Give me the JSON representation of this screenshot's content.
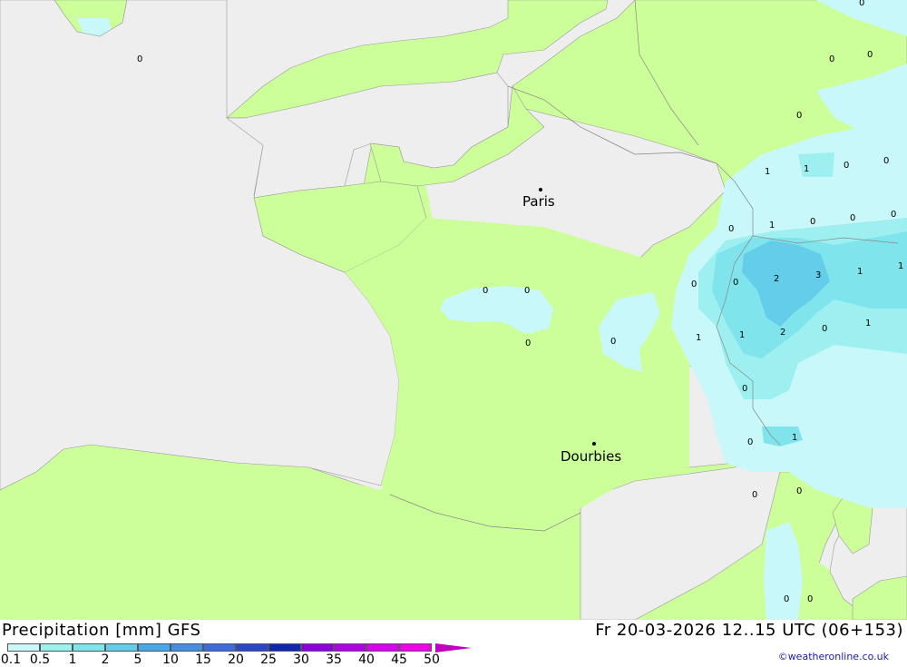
{
  "title": "Precipitation [mm] GFS",
  "datetime": "Fr 20-03-2026 12..15 UTC (06+153)",
  "credit": "©weatheronline.co.uk",
  "colors": {
    "sea": "#eeeeee",
    "land": "#ccff99",
    "p01": "#c8f8fa",
    "p05": "#9ef0f0",
    "p1": "#80e4ec",
    "p2": "#64cdea",
    "p5": "#4ba8e6"
  },
  "cities": [
    {
      "name": "Paris"
    },
    {
      "name": "Dourbies"
    }
  ],
  "values": [
    "0",
    "0",
    "0",
    "0",
    "0",
    "1",
    "1",
    "0",
    "0",
    "0",
    "0",
    "1",
    "0",
    "0",
    "0",
    "2",
    "3",
    "1",
    "1",
    "0",
    "0",
    "0",
    "0",
    "1",
    "1",
    "2",
    "0",
    "1",
    "0",
    "0",
    "1",
    "0",
    "0",
    "0",
    "0",
    "0",
    "0"
  ],
  "legend": {
    "labels": [
      "0.1",
      "0.5",
      "1",
      "2",
      "5",
      "10",
      "15",
      "20",
      "25",
      "30",
      "35",
      "40",
      "45",
      "50"
    ],
    "colors": [
      "#c8f8fa",
      "#9ef0f0",
      "#80e4ec",
      "#64cdea",
      "#4ba8e6",
      "#4a8ce0",
      "#3c6cdc",
      "#2848c8",
      "#1028b0",
      "#8c00e0",
      "#b000e8",
      "#d800f0",
      "#ee00e8",
      "#c000c0"
    ]
  }
}
